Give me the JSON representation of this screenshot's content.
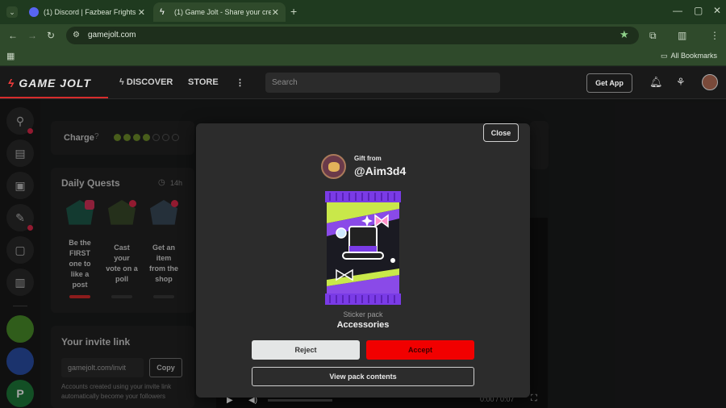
{
  "browser": {
    "tabs": [
      {
        "title": "(1) Discord | Fazbear Frights",
        "active": false
      },
      {
        "title": "(1) Game Jolt - Share your cre",
        "active": true
      }
    ],
    "url": "gamejolt.com",
    "bookmarks_label": "All Bookmarks"
  },
  "site": {
    "logo": "GAME JOLT",
    "nav": {
      "discover": "DISCOVER",
      "store": "STORE"
    },
    "search_placeholder": "Search",
    "get_app": "Get App"
  },
  "sidebar_content": {
    "charge_label": "Charge",
    "daily_quests_title": "Daily Quests",
    "daily_quests_timer": "14h",
    "quests": [
      {
        "label": "Be the FIRST one to like a post"
      },
      {
        "label": "Cast your vote on a poll"
      },
      {
        "label": "Get an item from the shop"
      }
    ],
    "invite_title": "Your invite link",
    "invite_value": "gamejolt.com/invit",
    "copy_label": "Copy",
    "invite_desc": "Accounts created using your invite link automatically become your followers"
  },
  "video": {
    "time": "0:00 / 0:07"
  },
  "modal": {
    "close_label": "Close",
    "gift_from_label": "Gift from",
    "sender": "@Aim3d4",
    "pack_type": "Sticker pack",
    "pack_name": "Accessories",
    "reject_label": "Reject",
    "accept_label": "Accept",
    "view_label": "View pack contents"
  },
  "colors": {
    "accent_red": "#f10000",
    "chrome_green": "#2f4a2b",
    "modal_bg": "#2c2c2c",
    "pack_purple": "#7a3be6"
  }
}
